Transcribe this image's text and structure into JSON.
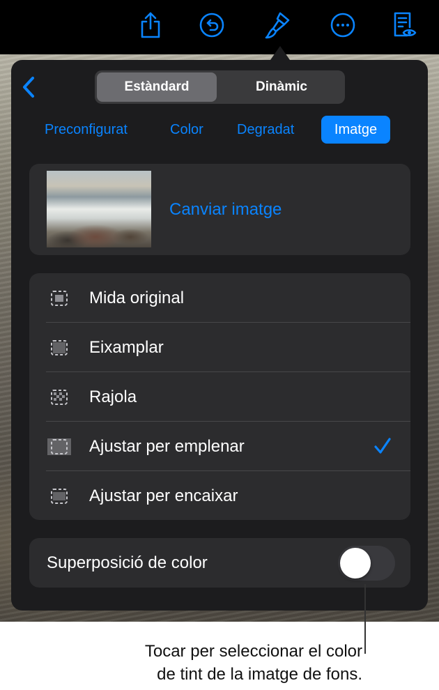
{
  "toolbar": {
    "icons": [
      "share-icon",
      "undo-icon",
      "format-brush-icon",
      "more-icon",
      "reader-view-icon"
    ],
    "icon_color": "#0a84ff"
  },
  "segmented": {
    "options": [
      "Estàndard",
      "Dinàmic"
    ],
    "selected": "Estàndard"
  },
  "tabs": {
    "items": [
      "Preconfigurat",
      "Color",
      "Degradat",
      "Imatge"
    ],
    "selected": "Imatge"
  },
  "image_card": {
    "change_label": "Canviar imatge"
  },
  "scale_options": {
    "items": [
      {
        "label": "Mida original",
        "icon": "original-size-icon"
      },
      {
        "label": "Eixamplar",
        "icon": "stretch-icon"
      },
      {
        "label": "Rajola",
        "icon": "tile-icon"
      },
      {
        "label": "Ajustar per emplenar",
        "icon": "scale-to-fill-icon"
      },
      {
        "label": "Ajustar per encaixar",
        "icon": "scale-to-fit-icon"
      }
    ],
    "selected": "Ajustar per emplenar"
  },
  "color_overlay": {
    "label": "Superposició de color",
    "enabled": false
  },
  "callout": {
    "line1": "Tocar per seleccionar el color",
    "line2": "de tint de la imatge de fons."
  },
  "colors": {
    "accent": "#0a84ff",
    "popover_bg": "#1c1c1e",
    "card_bg": "#2c2c2e"
  }
}
